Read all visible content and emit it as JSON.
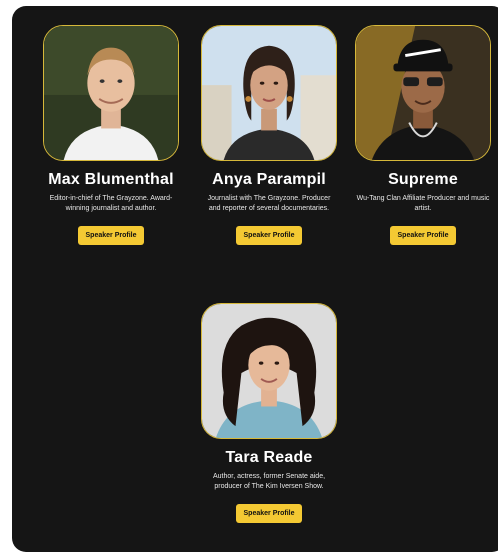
{
  "speakers": [
    {
      "name": "Max Blumenthal",
      "bio": "Editor-in-chief of The Grayzone. Award-winning journalist and author.",
      "button": "Speaker Profile"
    },
    {
      "name": "Anya Parampil",
      "bio": "Journalist with The Grayzone. Producer and reporter of several documentaries.",
      "button": "Speaker Profile"
    },
    {
      "name": "Supreme",
      "bio": "Wu-Tang Clan Affiliate Producer and music artist.",
      "button": "Speaker Profile"
    },
    {
      "name": "Tara Reade",
      "bio": "Author, actress, former Senate aide, producer of The Kim Iversen Show.",
      "button": "Speaker Profile"
    }
  ],
  "colors": {
    "panel": "#151515",
    "accent": "#f4c933",
    "photo_border": "#d6b83a"
  }
}
